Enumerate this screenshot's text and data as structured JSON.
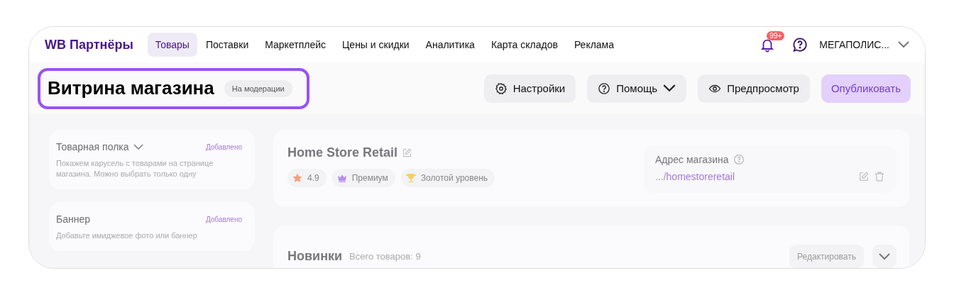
{
  "logo": "WB Партнёры",
  "nav": [
    {
      "label": "Товары",
      "selected": true
    },
    {
      "label": "Поставки",
      "selected": false
    },
    {
      "label": "Маркетплейс",
      "selected": false
    },
    {
      "label": "Цены и скидки",
      "selected": false
    },
    {
      "label": "Аналитика",
      "selected": false
    },
    {
      "label": "Карта складов",
      "selected": false
    },
    {
      "label": "Реклама",
      "selected": false
    }
  ],
  "notifications": {
    "badge": "99+"
  },
  "account": {
    "name": "МЕГАПОЛИС..."
  },
  "header": {
    "title": "Витрина магазина",
    "status": "На модерации",
    "highlighted": true
  },
  "actions": [
    {
      "label": "Настройки",
      "kind": "secondary",
      "disabled": false
    },
    {
      "label": "Помощь",
      "kind": "dropdown",
      "disabled": false
    },
    {
      "label": "Предпросмотр",
      "kind": "secondary",
      "disabled": false
    },
    {
      "label": "Опубликовать",
      "kind": "primary",
      "disabled": true
    }
  ],
  "sidebar": [
    {
      "title": "Товарная полка",
      "kind": "dropdown",
      "status": "Добавлено",
      "description": "Покажем карусель с товарами на странице магазина. Можно выбрать только одну"
    },
    {
      "title": "Баннер",
      "kind": "plain",
      "status": "Добавлено",
      "description": "Добавьте имиджевое фото или баннер"
    }
  ],
  "store": {
    "name": "Home Store Retail",
    "badges": [
      {
        "text": "4.9"
      },
      {
        "text": "Премиум"
      },
      {
        "text": "Золотой уровень"
      }
    ],
    "address": {
      "label": "Адрес магазина",
      "prefix": ".../",
      "slug": "homestoreretail"
    }
  },
  "section": {
    "title": "Новинки",
    "count": "Всего товаров: 9",
    "edit": "Редактировать"
  }
}
